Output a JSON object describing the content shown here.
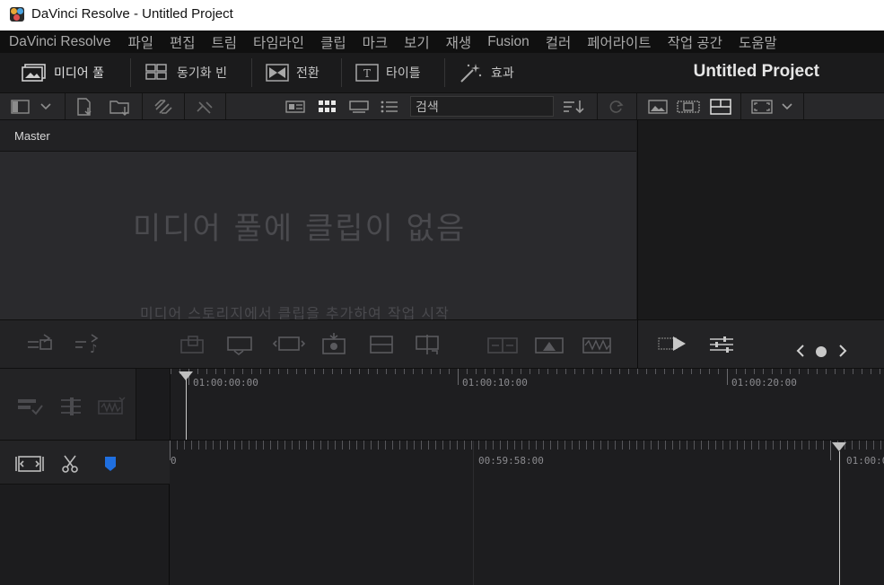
{
  "window": {
    "title": "DaVinci Resolve - Untitled Project"
  },
  "menu": [
    "DaVinci Resolve",
    "파일",
    "편집",
    "트림",
    "타임라인",
    "클립",
    "마크",
    "보기",
    "재생",
    "Fusion",
    "컬러",
    "페어라이트",
    "작업 공간",
    "도움말"
  ],
  "toolbar": {
    "media_pool": "미디어 풀",
    "sync_bin": "동기화 빈",
    "transitions": "전환",
    "titles": "타이틀",
    "effects": "효과",
    "project_name": "Untitled Project"
  },
  "search": {
    "placeholder": "검색"
  },
  "bin": {
    "name": "Master"
  },
  "media_pool": {
    "empty_title": "미디어 풀에 클립이 없음",
    "empty_hint": "미디어 스토리지에서 클립을 추가하여 작업 시작"
  },
  "timeline": {
    "upper_timecodes": [
      "01:00:00:00",
      "01:00:10:00",
      "01:00:20:00"
    ],
    "lower_timecodes": [
      "0",
      "00:59:58:00",
      "01:00:0"
    ]
  },
  "colors": {
    "accent_blue": "#1f6fe0",
    "background": "#1e1e1f",
    "menubar": "#101010"
  }
}
